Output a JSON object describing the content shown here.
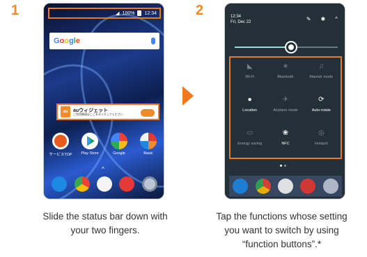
{
  "step1": {
    "number": "1",
    "caption_line1": "Slide the status bar down with",
    "caption_line2": "your two fingers.",
    "statusbar": {
      "battery": "100%",
      "time": "12:34"
    },
    "search": {
      "logo_letters": [
        "G",
        "o",
        "o",
        "g",
        "l",
        "e"
      ]
    },
    "widget": {
      "badge": "au",
      "title": "auウィジェット",
      "subtitle": "ご利用開始はここをタッチしてください"
    },
    "apps": [
      {
        "label": "サービスTOP",
        "color": "#e85a1e",
        "icon": "au-service-icon"
      },
      {
        "label": "Play Store",
        "color": "#ffffff",
        "icon": "play-store-icon"
      },
      {
        "label": "Google",
        "color": "#d9d9d9",
        "icon": "google-folder-icon"
      },
      {
        "label": "Basic",
        "color": "#f2f2f2",
        "icon": "basic-folder-icon"
      }
    ],
    "dock": [
      {
        "color": "#1e88e5",
        "icon": "phone-icon"
      },
      {
        "color": "#ea4335",
        "icon": "chrome-icon"
      },
      {
        "color": "#f4f4f4",
        "icon": "mail-icon"
      },
      {
        "color": "#e53935",
        "icon": "gift-icon"
      },
      {
        "color": "#bcc6d6",
        "icon": "camera-icon"
      }
    ]
  },
  "step2": {
    "number": "2",
    "caption_line1": "Tap the functions whose setting",
    "caption_line2": "you want to switch by using",
    "caption_line3": "“function buttons”.*",
    "time": "12:34",
    "date": "Fri, Dec 22",
    "brightness_level": 0.55,
    "tiles": [
      {
        "label": "Wi-Fi",
        "glyph": "◣",
        "active": false,
        "icon": "wifi-icon"
      },
      {
        "label": "Bluetooth",
        "glyph": "∗",
        "active": false,
        "icon": "bluetooth-icon"
      },
      {
        "label": "Manner mode",
        "glyph": "♫",
        "active": false,
        "icon": "manner-mode-icon"
      },
      {
        "label": "Location",
        "glyph": "●",
        "active": true,
        "icon": "location-icon"
      },
      {
        "label": "Airplane mode",
        "glyph": "✈",
        "active": false,
        "icon": "airplane-icon"
      },
      {
        "label": "Auto-rotate",
        "glyph": "⟳",
        "active": true,
        "icon": "auto-rotate-icon"
      },
      {
        "label": "Energy saving",
        "glyph": "▭",
        "active": false,
        "icon": "energy-saving-icon"
      },
      {
        "label": "NFC",
        "glyph": "❀",
        "active": true,
        "icon": "nfc-icon"
      },
      {
        "label": "Hotspot",
        "glyph": "◎",
        "active": false,
        "icon": "hotspot-icon"
      }
    ]
  },
  "colors": {
    "accent": "#f0781e",
    "qs_background": "#243037"
  }
}
